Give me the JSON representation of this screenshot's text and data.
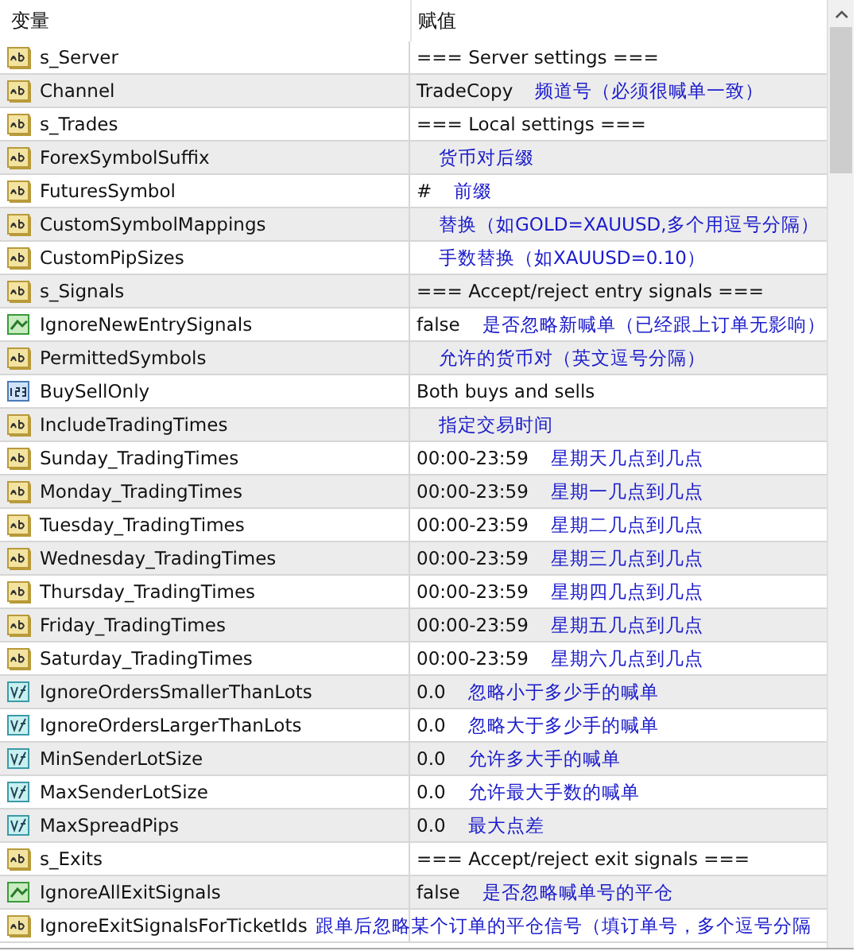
{
  "table": {
    "columns": [
      "变量",
      "赋值"
    ],
    "rows": [
      {
        "kind": "string",
        "name": "s_Server",
        "value": "=== Server settings ==="
      },
      {
        "kind": "string",
        "name": "Channel",
        "value": "TradeCopy",
        "note": "频道号（必须很喊单一致）"
      },
      {
        "kind": "string",
        "name": "s_Trades",
        "value": "=== Local settings ==="
      },
      {
        "kind": "string",
        "name": "ForexSymbolSuffix",
        "note": "货币对后缀"
      },
      {
        "kind": "string",
        "name": "FuturesSymbol",
        "value": "#",
        "note": "前缀"
      },
      {
        "kind": "string",
        "name": "CustomSymbolMappings",
        "note": "替换（如GOLD=XAUUSD,多个用逗号分隔）"
      },
      {
        "kind": "string",
        "name": "CustomPipSizes",
        "note": "手数替换（如XAUUSD=0.10）"
      },
      {
        "kind": "string",
        "name": "s_Signals",
        "value": "=== Accept/reject entry signals ==="
      },
      {
        "kind": "bool",
        "name": "IgnoreNewEntrySignals",
        "value": "false",
        "note": "是否忽略新喊单（已经跟上订单无影响）"
      },
      {
        "kind": "string",
        "name": "PermittedSymbols",
        "note": "允许的货币对（英文逗号分隔）"
      },
      {
        "kind": "enum",
        "name": "BuySellOnly",
        "value": "Both buys and sells"
      },
      {
        "kind": "string",
        "name": "IncludeTradingTimes",
        "note": "指定交易时间"
      },
      {
        "kind": "string",
        "name": "Sunday_TradingTimes",
        "value": "00:00-23:59",
        "note": "星期天几点到几点"
      },
      {
        "kind": "string",
        "name": "Monday_TradingTimes",
        "value": "00:00-23:59",
        "note": "星期一几点到几点"
      },
      {
        "kind": "string",
        "name": "Tuesday_TradingTimes",
        "value": "00:00-23:59",
        "note": "星期二几点到几点"
      },
      {
        "kind": "string",
        "name": "Wednesday_TradingTimes",
        "value": "00:00-23:59",
        "note": "星期三几点到几点"
      },
      {
        "kind": "string",
        "name": "Thursday_TradingTimes",
        "value": "00:00-23:59",
        "note": "星期四几点到几点"
      },
      {
        "kind": "string",
        "name": "Friday_TradingTimes",
        "value": "00:00-23:59",
        "note": "星期五几点到几点"
      },
      {
        "kind": "string",
        "name": "Saturday_TradingTimes",
        "value": "00:00-23:59",
        "note": "星期六几点到几点"
      },
      {
        "kind": "double",
        "name": "IgnoreOrdersSmallerThanLots",
        "value": "0.0",
        "note": "忽略小于多少手的喊单"
      },
      {
        "kind": "double",
        "name": "IgnoreOrdersLargerThanLots",
        "value": "0.0",
        "note": "忽略大于多少手的喊单"
      },
      {
        "kind": "double",
        "name": "MinSenderLotSize",
        "value": "0.0",
        "note": "允许多大手的喊单"
      },
      {
        "kind": "double",
        "name": "MaxSenderLotSize",
        "value": "0.0",
        "note": "允许最大手数的喊单"
      },
      {
        "kind": "double",
        "name": "MaxSpreadPips",
        "value": "0.0",
        "note": "最大点差"
      },
      {
        "kind": "string",
        "name": "s_Exits",
        "value": "=== Accept/reject exit signals ==="
      },
      {
        "kind": "bool",
        "name": "IgnoreAllExitSignals",
        "value": "false",
        "note": "是否忽略喊单号的平仓"
      },
      {
        "kind": "string",
        "name": "IgnoreExitSignalsForTicketIds",
        "inline_note": "跟单后忽略某个订单的平仓信号（填订单号，多个逗号分隔"
      }
    ]
  }
}
